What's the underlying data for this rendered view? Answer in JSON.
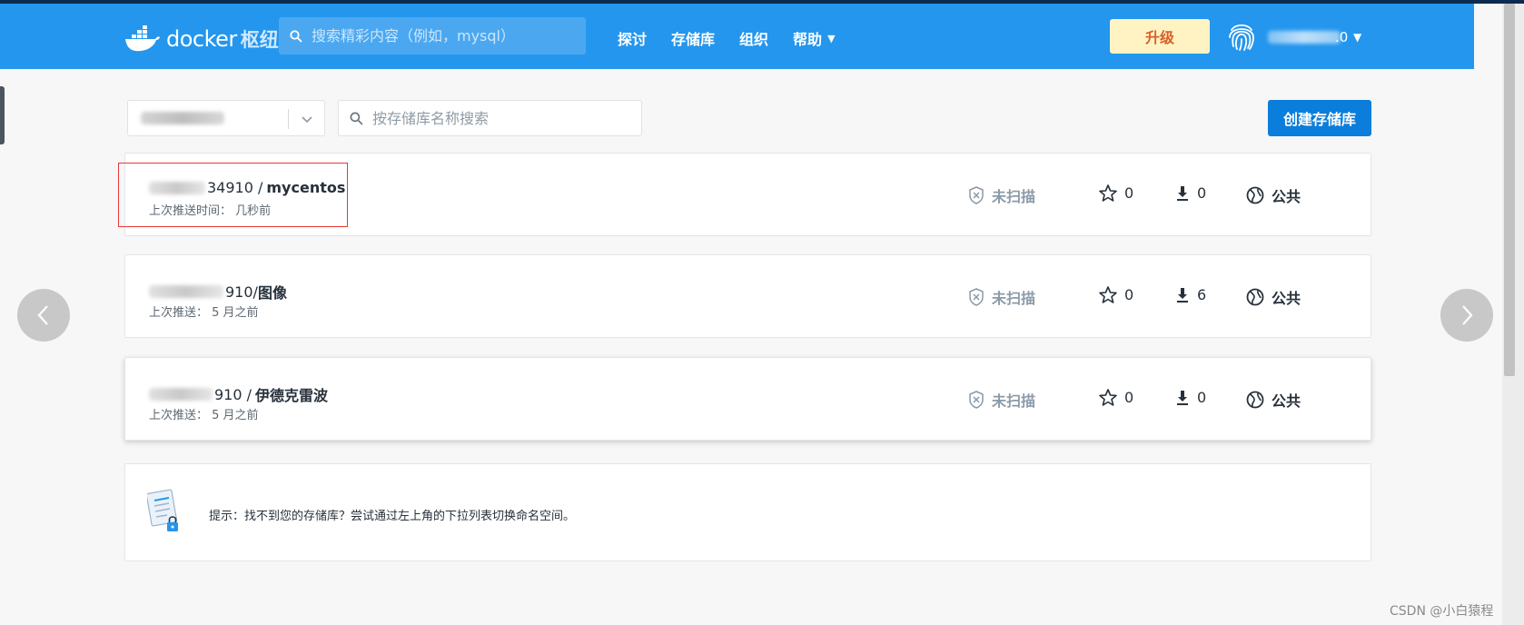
{
  "nav": {
    "logo_text": "docker",
    "logo_sub": "枢纽",
    "search_placeholder": "搜索精彩内容（例如，mysql）",
    "links": [
      {
        "label": "探讨"
      },
      {
        "label": "存储库"
      },
      {
        "label": "组织"
      },
      {
        "label": "帮助"
      }
    ],
    "upgrade_label": "升级",
    "user_suffix": ".0"
  },
  "toolbar": {
    "repo_search_placeholder": "按存储库名称搜索",
    "create_label": "创建存储库"
  },
  "repos": [
    {
      "prefix": "34910 /",
      "name": "mycentos",
      "sub": "上次推送时间：  几秒前",
      "scan": "未扫描",
      "stars": "0",
      "pulls": "0",
      "visibility": "公共"
    },
    {
      "prefix": "910/",
      "name": "图像",
      "sub": "上次推送：  5 月之前",
      "scan": "未扫描",
      "stars": "0",
      "pulls": "6",
      "visibility": "公共"
    },
    {
      "prefix": "910 /",
      "name": "伊德克雷波",
      "sub": "上次推送：  5 月之前",
      "scan": "未扫描",
      "stars": "0",
      "pulls": "0",
      "visibility": "公共"
    }
  ],
  "tip": {
    "text": "提示：找不到您的存储库？尝试通过左上角的下拉列表切换命名空间。"
  },
  "watermark": "CSDN @小白猿程",
  "colors": {
    "navbar": "#2496ed",
    "primary_button": "#0b7dda",
    "upgrade_bg": "#fff3c4",
    "upgrade_text": "#d8602b",
    "highlight": "#e53935"
  }
}
